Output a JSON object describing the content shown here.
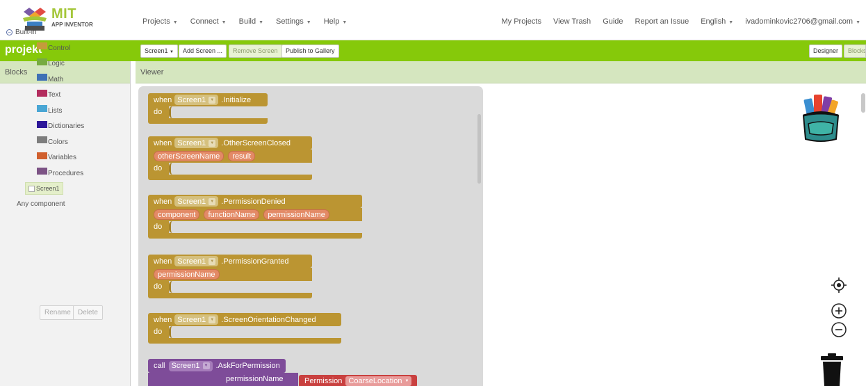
{
  "logo": {
    "title": "MIT",
    "subtitle": "APP INVENTOR"
  },
  "nav_left": [
    "Projects",
    "Connect",
    "Build",
    "Settings",
    "Help"
  ],
  "nav_right": {
    "my_projects": "My Projects",
    "view_trash": "View Trash",
    "guide": "Guide",
    "report": "Report an Issue",
    "language": "English",
    "account": "ivadominkovic2706@gmail.com"
  },
  "toolbar": {
    "project_name": "projekt",
    "screen_select": "Screen1",
    "add_screen": "Add Screen ...",
    "remove_screen": "Remove Screen",
    "publish": "Publish to Gallery",
    "designer": "Designer",
    "blocks": "Blocks"
  },
  "blocks_panel": {
    "title": "Blocks",
    "root": "Built-in",
    "builtins": [
      {
        "label": "Control",
        "color": "#c59b3c"
      },
      {
        "label": "Logic",
        "color": "#77ab41"
      },
      {
        "label": "Math",
        "color": "#3f71b5"
      },
      {
        "label": "Text",
        "color": "#b32d5e"
      },
      {
        "label": "Lists",
        "color": "#49a6d4"
      },
      {
        "label": "Dictionaries",
        "color": "#2d1799"
      },
      {
        "label": "Colors",
        "color": "#7d7d7d"
      },
      {
        "label": "Variables",
        "color": "#d05f2d"
      },
      {
        "label": "Procedures",
        "color": "#7c5385"
      }
    ],
    "screen": "Screen1",
    "any_component": "Any component",
    "rename": "Rename",
    "delete": "Delete"
  },
  "viewer": {
    "title": "Viewer",
    "blocks": [
      {
        "when": "when",
        "component": "Screen1",
        "event": ".Initialize",
        "params": [],
        "do": "do"
      },
      {
        "when": "when",
        "component": "Screen1",
        "event": ".OtherScreenClosed",
        "params": [
          "otherScreenName",
          "result"
        ],
        "do": "do"
      },
      {
        "when": "when",
        "component": "Screen1",
        "event": ".PermissionDenied",
        "params": [
          "component",
          "functionName",
          "permissionName"
        ],
        "do": "do"
      },
      {
        "when": "when",
        "component": "Screen1",
        "event": ".PermissionGranted",
        "params": [
          "permissionName"
        ],
        "do": "do"
      },
      {
        "when": "when",
        "component": "Screen1",
        "event": ".ScreenOrientationChanged",
        "params": [],
        "do": "do"
      }
    ],
    "call_block": {
      "call": "call",
      "component": "Screen1",
      "method": ".AskForPermission",
      "param": "permissionName",
      "permission_label": "Permission",
      "permission_value": "CoarseLocation"
    }
  }
}
